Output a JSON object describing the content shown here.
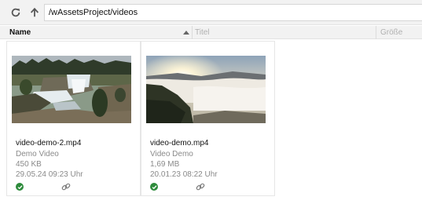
{
  "toolbar": {
    "refresh_icon": "refresh-icon",
    "up_icon": "arrow-up-icon",
    "path": "/wAssetsProject/videos"
  },
  "columns": {
    "name": "Name",
    "title": "Titel",
    "size": "Größe",
    "sort_direction": "ascending"
  },
  "files": [
    {
      "filename": "video-demo-2.mp4",
      "title": "Demo Video",
      "size": "450 KB",
      "date": "29.05.24 09:23 Uhr",
      "status_icon": "check-circle-icon",
      "link_icon": "link-icon"
    },
    {
      "filename": "video-demo.mp4",
      "title": "Video Demo",
      "size": "1,69 MB",
      "date": "20.01.23 08:22 Uhr",
      "status_icon": "check-circle-icon",
      "link_icon": "link-icon"
    }
  ],
  "colors": {
    "status_ok": "#2e8b3c",
    "toolbar_bg": "#f2f2f2"
  }
}
